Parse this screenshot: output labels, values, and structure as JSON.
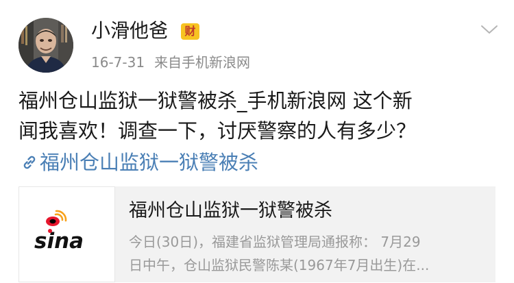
{
  "post": {
    "username": "小滑他爸",
    "badge": "财",
    "time": "16-7-31",
    "source": "来自手机新浪网",
    "text_line1": "福州仓山监狱一狱警被杀_手机新浪网 这个新",
    "text_line2": "闻我喜欢！调查一下，讨厌警察的人有多少？",
    "link_text": "福州仓山监狱一狱警被杀",
    "icons": {
      "avatar": "avatar",
      "chevron": "chevron-down-icon",
      "link": "link-icon",
      "card_logo": "sina-logo"
    },
    "colors": {
      "link": "#4a7fb5",
      "meta": "#8a8a8a",
      "card_bg": "#f2f2f2",
      "badge_bg": "#f7c322",
      "sina_red": "#e6162d"
    }
  },
  "card": {
    "title": "福州仓山监狱一狱警被杀",
    "desc_line1": "今日(30日)，福建省监狱管理局通报称：  7月29",
    "desc_line2": "日中午，仓山监狱民警陈某(1967年7月出生)在..."
  }
}
